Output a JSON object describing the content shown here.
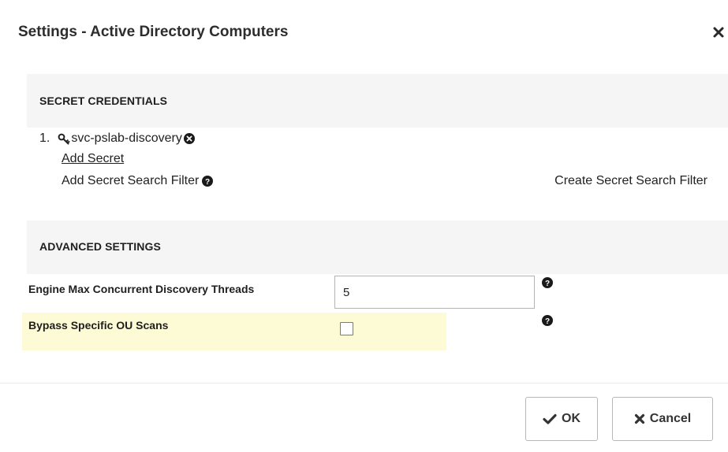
{
  "dialog": {
    "title": "Settings - Active Directory Computers",
    "close_icon": "close-icon"
  },
  "secret_credentials": {
    "heading": "SECRET CREDENTIALS",
    "items": [
      {
        "number": "1.",
        "name": "svc-pslab-discovery",
        "icon": "key-icon"
      }
    ],
    "add_secret_label": "Add Secret",
    "add_filter_label": "Add Secret Search Filter",
    "create_filter_label": "Create Secret Search Filter"
  },
  "advanced_settings": {
    "heading": "ADVANCED SETTINGS",
    "threads_label": "Engine Max Concurrent Discovery Threads",
    "threads_value": "5",
    "bypass_label": "Bypass Specific OU Scans",
    "bypass_checked": false
  },
  "footer": {
    "ok_label": "OK",
    "cancel_label": "Cancel"
  },
  "colors": {
    "section_band": "#f5f5f6",
    "highlight_row": "#fcfbd5",
    "text": "#1f1f1f"
  }
}
